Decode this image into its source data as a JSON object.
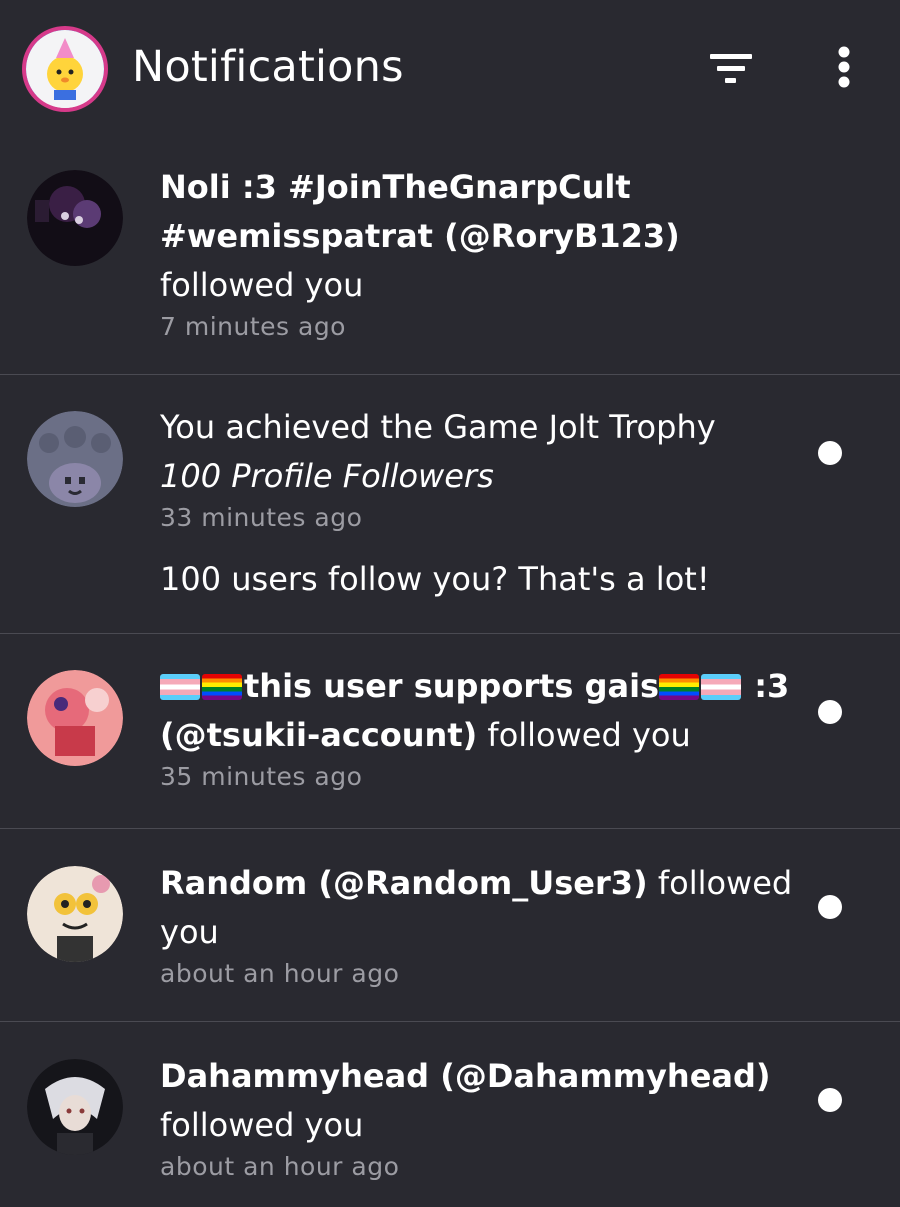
{
  "header": {
    "title": "Notifications",
    "filter_icon": "filter-icon",
    "more_icon": "more-vertical-icon"
  },
  "notifications": [
    {
      "name": "Noli :3 #JoinTheGnarpCult",
      "name2": "#wemisspatrat (@RoryB123)",
      "action": "followed you",
      "time": "7 minutes ago",
      "unread": false
    },
    {
      "line1": "You achieved the Game Jolt Trophy",
      "trophy": "100 Profile Followers",
      "time": "33 minutes ago",
      "description": "100 users follow you? That's a lot!",
      "unread": true
    },
    {
      "name_part1": "this user supports gais",
      "name_part2": " :3",
      "handle": "(@tsukii-account)",
      "action": " followed you",
      "time": "35 minutes ago",
      "unread": true
    },
    {
      "name": "Random (@Random_User3)",
      "action_part1": " followed",
      "action_part2": "you",
      "time": "about an hour ago",
      "unread": true
    },
    {
      "name": "Dahammyhead (@Dahammyhead)",
      "action": "followed you",
      "time": "about an hour ago",
      "unread": true
    }
  ],
  "colors": {
    "background": "#292930",
    "divider": "#4a4a52",
    "muted_text": "#9c9ca3",
    "header_avatar_ring": "#d63a8a"
  }
}
